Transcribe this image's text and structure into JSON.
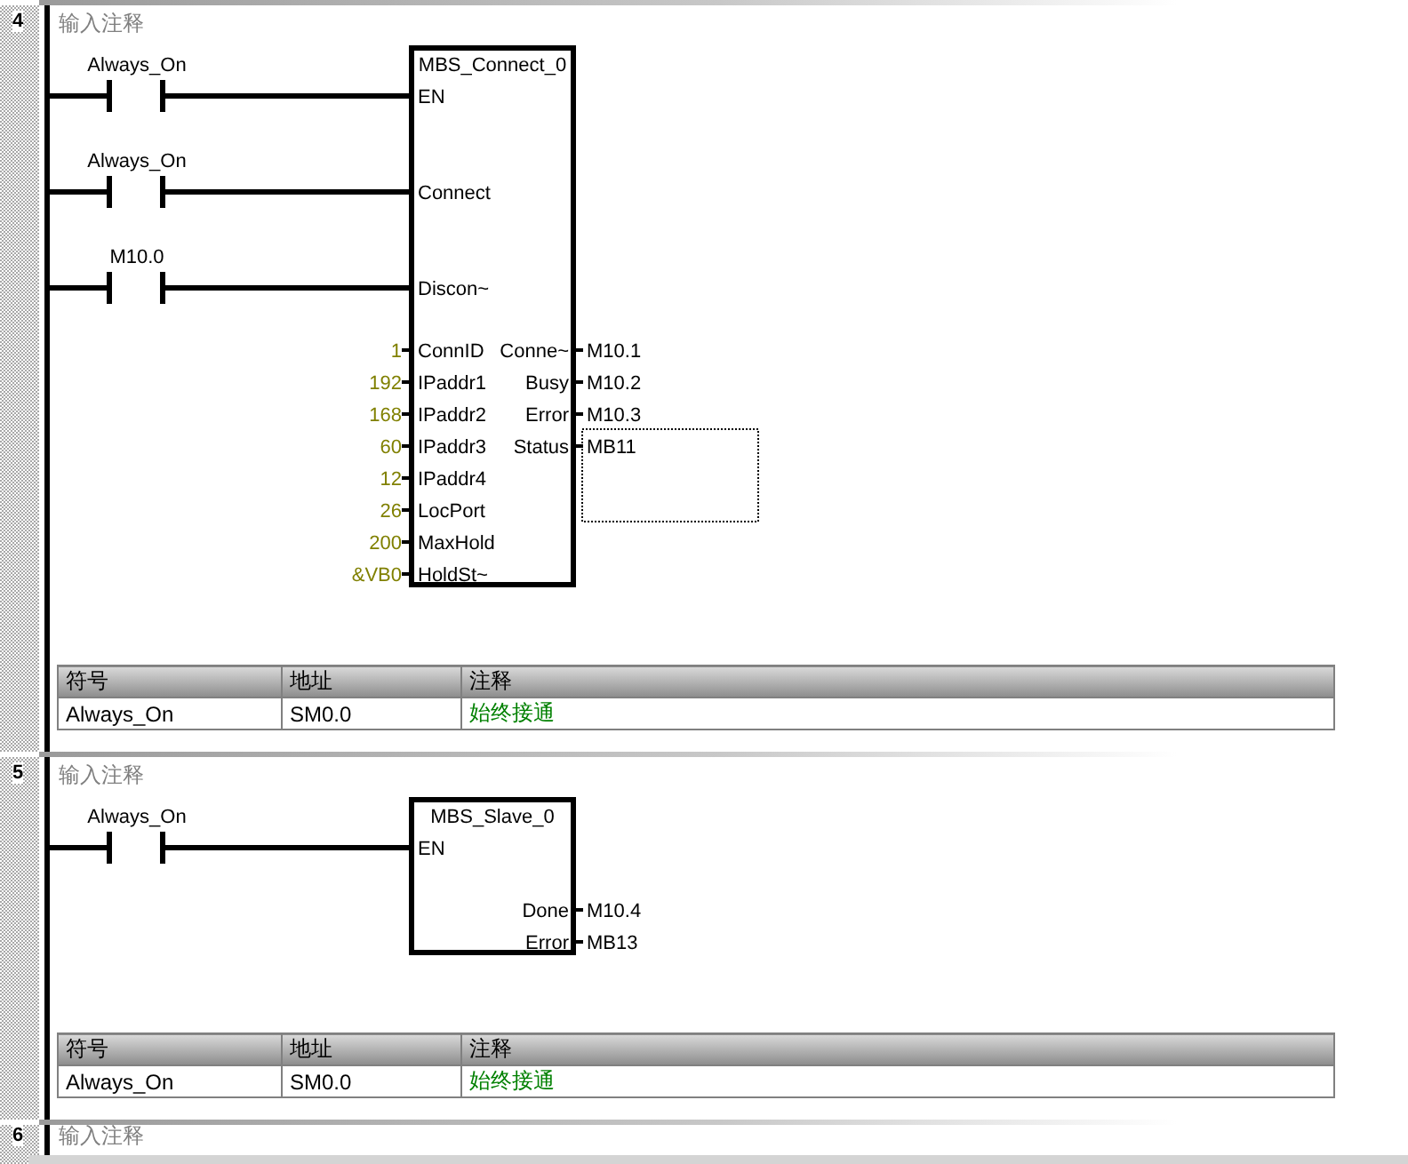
{
  "networks": [
    {
      "number": "4",
      "comment": "输入注释",
      "block": {
        "title": "MBS_Connect_0",
        "inputs": [
          {
            "kind": "contact",
            "pin": "EN",
            "contact": "Always_On"
          },
          {
            "kind": "contact",
            "pin": "Connect",
            "contact": "Always_On"
          },
          {
            "kind": "contact",
            "pin": "Discon~",
            "contact": "M10.0"
          },
          {
            "kind": "value",
            "pin": "ConnID",
            "value": "1"
          },
          {
            "kind": "value",
            "pin": "IPaddr1",
            "value": "192"
          },
          {
            "kind": "value",
            "pin": "IPaddr2",
            "value": "168"
          },
          {
            "kind": "value",
            "pin": "IPaddr3",
            "value": "60"
          },
          {
            "kind": "value",
            "pin": "IPaddr4",
            "value": "12"
          },
          {
            "kind": "value",
            "pin": "LocPort",
            "value": "26"
          },
          {
            "kind": "value",
            "pin": "MaxHold",
            "value": "200"
          },
          {
            "kind": "value",
            "pin": "HoldSt~",
            "value": "&VB0"
          }
        ],
        "outputs": [
          {
            "pin": "Conne~",
            "value": "M10.1",
            "selected": false
          },
          {
            "pin": "Busy",
            "value": "M10.2",
            "selected": false
          },
          {
            "pin": "Error",
            "value": "M10.3",
            "selected": false
          },
          {
            "pin": "Status",
            "value": "MB11",
            "selected": true
          }
        ]
      },
      "symbol_table": {
        "columns": [
          "符号",
          "地址",
          "注释"
        ],
        "rows": [
          [
            "Always_On",
            "SM0.0",
            "始终接通"
          ]
        ]
      }
    },
    {
      "number": "5",
      "comment": "输入注释",
      "block": {
        "title": "MBS_Slave_0",
        "inputs": [
          {
            "kind": "contact",
            "pin": "EN",
            "contact": "Always_On"
          }
        ],
        "outputs": [
          {
            "pin": "Done",
            "value": "M10.4",
            "selected": false
          },
          {
            "pin": "Error",
            "value": "MB13",
            "selected": false
          }
        ]
      },
      "symbol_table": {
        "columns": [
          "符号",
          "地址",
          "注释"
        ],
        "rows": [
          [
            "Always_On",
            "SM0.0",
            "始终接通"
          ]
        ]
      }
    },
    {
      "number": "6",
      "comment": "输入注释"
    }
  ]
}
